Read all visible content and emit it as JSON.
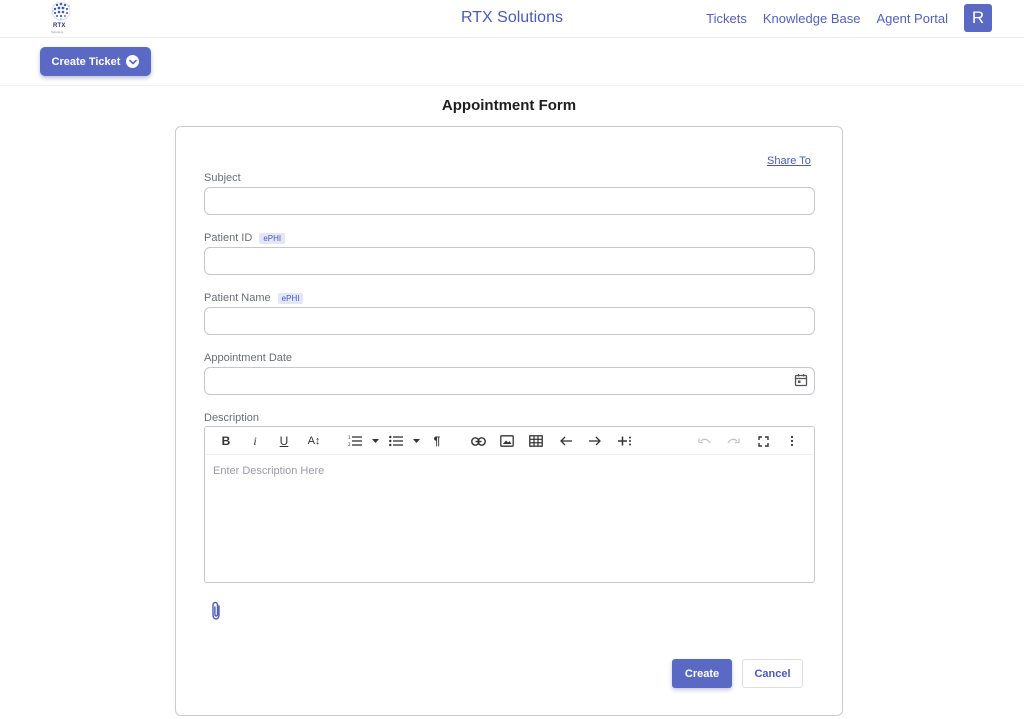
{
  "header": {
    "logo_text": "RTX",
    "logo_sub": "Solutions",
    "app_title": "RTX Solutions",
    "nav": [
      "Tickets",
      "Knowledge Base",
      "Agent Portal"
    ],
    "avatar_letter": "R"
  },
  "subbar": {
    "create_ticket_label": "Create Ticket"
  },
  "form": {
    "title": "Appointment Form",
    "share_label": "Share To",
    "subject_label": "Subject",
    "patient_id_label": "Patient ID",
    "patient_name_label": "Patient Name",
    "ephi_badge": "ePHI",
    "appointment_date_label": "Appointment Date",
    "description_label": "Description",
    "description_placeholder": "Enter Description Here",
    "create_label": "Create",
    "cancel_label": "Cancel"
  },
  "toolbar": {
    "bold": "B",
    "italic": "i",
    "underline": "U",
    "font_size": "A↕",
    "paragraph": "¶"
  },
  "colors": {
    "accent": "#5a69c4",
    "link": "#4a5bb8",
    "badge_bg": "#e3e6f6"
  }
}
